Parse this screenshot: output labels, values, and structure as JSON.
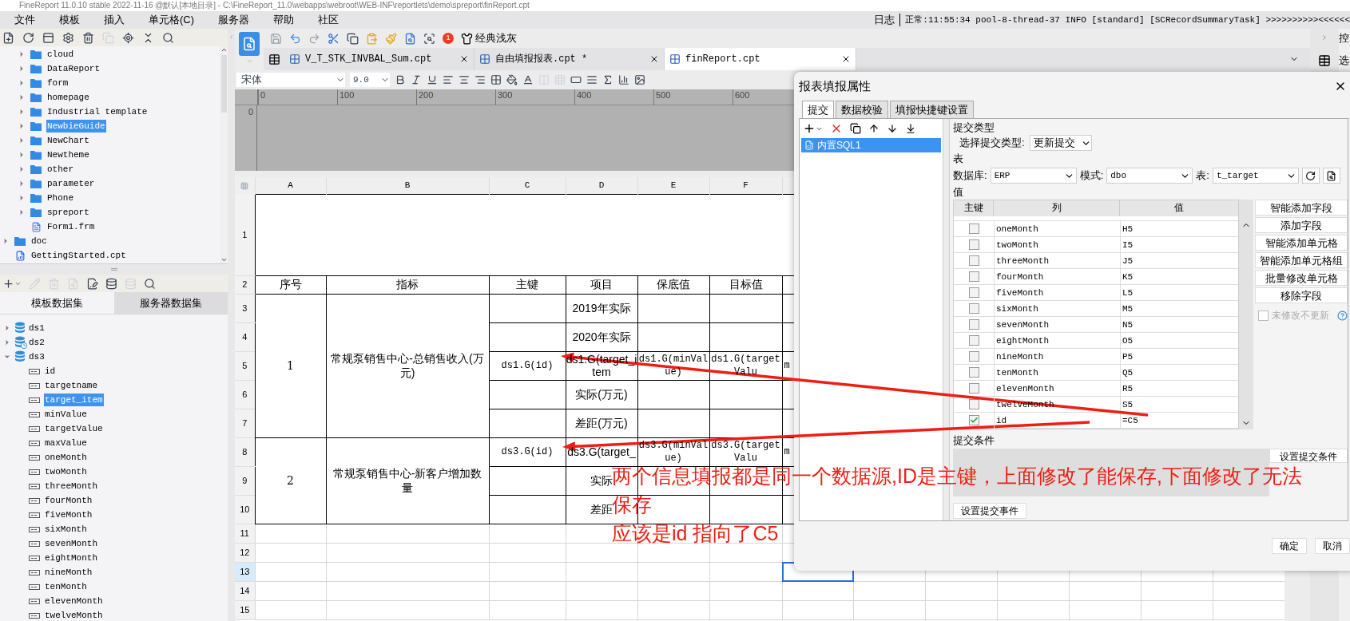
{
  "window": {
    "title": "FineReport 11.0.10 stable 2022-11-16 @默认[本地目录]  - C:\\FineReport_11.0\\webapps\\webroot\\WEB-INF\\reportlets\\demo\\spreport\\finReport.cpt"
  },
  "menu": [
    "文件",
    "模板",
    "插入",
    "单元格(C)",
    "服务器",
    "帮助",
    "社区"
  ],
  "log": {
    "label": "日志",
    "message": "正常:11:55:34 pool-8-thread-37 INFO [standard] [SCRecordSummaryTask] >>>>>>>>>><<<<<<"
  },
  "template_tree": [
    {
      "children": [
        {
          "label": "cloud",
          "kind": "folder",
          "expanded": false,
          "selected": false
        },
        {
          "label": "DataReport",
          "kind": "folder",
          "expanded": false,
          "selected": false
        },
        {
          "label": "form",
          "kind": "folder",
          "expanded": false,
          "selected": false
        },
        {
          "label": "homepage",
          "kind": "folder",
          "expanded": false,
          "selected": false
        },
        {
          "label": "Industrial template",
          "kind": "folder",
          "expanded": false,
          "selected": false
        },
        {
          "label": "NewbieGuide",
          "kind": "folder",
          "expanded": false,
          "selected": true
        },
        {
          "label": "NewChart",
          "kind": "folder",
          "expanded": false,
          "selected": false
        },
        {
          "label": "Newtheme",
          "kind": "folder",
          "expanded": false,
          "selected": false
        },
        {
          "label": "other",
          "kind": "folder",
          "expanded": false,
          "selected": false
        },
        {
          "label": "parameter",
          "kind": "folder",
          "expanded": false,
          "selected": false
        },
        {
          "label": "Phone",
          "kind": "folder",
          "expanded": false,
          "selected": false
        },
        {
          "label": "spreport",
          "kind": "folder",
          "expanded": false,
          "selected": false
        },
        {
          "label": "Form1.frm",
          "kind": "form",
          "selected": false
        }
      ]
    },
    {
      "label": "doc",
      "kind": "folder",
      "expanded": false,
      "selected": false
    },
    {
      "label": "GettingStarted.cpt",
      "kind": "report",
      "selected": false
    }
  ],
  "dataset_panel": {
    "tabs": [
      {
        "label": "模板数据集",
        "selected": true
      },
      {
        "label": "服务器数据集",
        "selected": false
      }
    ],
    "datasets": [
      {
        "label": "ds1",
        "kind": "plain",
        "expanded": false
      },
      {
        "label": "ds2",
        "kind": "timed",
        "expanded": false
      },
      {
        "label": "ds3",
        "kind": "plain",
        "expanded": true,
        "children": [
          {
            "label": "id",
            "selected": false
          },
          {
            "label": "targetname",
            "selected": false
          },
          {
            "label": "target_item",
            "selected": true
          },
          {
            "label": "minValue",
            "selected": false
          },
          {
            "label": "targetValue",
            "selected": false
          },
          {
            "label": "maxValue",
            "selected": false
          },
          {
            "label": "oneMonth",
            "selected": false
          },
          {
            "label": "twoMonth",
            "selected": false
          },
          {
            "label": "threeMonth",
            "selected": false
          },
          {
            "label": "fourMonth",
            "selected": false
          },
          {
            "label": "fiveMonth",
            "selected": false
          },
          {
            "label": "sixMonth",
            "selected": false
          },
          {
            "label": "sevenMonth",
            "selected": false
          },
          {
            "label": "eightMonth",
            "selected": false
          },
          {
            "label": "nineMonth",
            "selected": false
          },
          {
            "label": "tenMonth",
            "selected": false
          },
          {
            "label": "elevenMonth",
            "selected": false
          },
          {
            "label": "twelveMonth",
            "selected": false
          }
        ]
      }
    ]
  },
  "editor": {
    "notification_count": "1",
    "theme": "经典浅灰",
    "tabs": [
      {
        "label": "V_T_STK_INVBAL_Sum.cpt",
        "selected": false
      },
      {
        "label": "自由填报报表.cpt *",
        "selected": false
      },
      {
        "label": "finReport.cpt",
        "selected": true
      }
    ],
    "font": "宋体",
    "font_size": "9.0",
    "ruler": [
      "0",
      "100",
      "200",
      "300",
      "400",
      "500",
      "600"
    ],
    "vertical_ruler": "0"
  },
  "sheet": {
    "columns": [
      "A",
      "B",
      "C",
      "D",
      "E",
      "F"
    ],
    "header": [
      "序号",
      "指标",
      "主键",
      "项目",
      "保底值",
      "目标值"
    ],
    "groups": [
      {
        "index": "1",
        "indicator": "常规泵销售中心-总销售收入(万元)",
        "rows": [
          {
            "item": "2019年实际"
          },
          {
            "item": "2020年实际"
          },
          {
            "key": "ds1.G(id)",
            "item": "ds1.G(target_item",
            "floor_value": "ds1.G(minValue)",
            "target_value": "ds1.G(targetValu",
            "column_7": "m"
          },
          {
            "item": "实际(万元)"
          },
          {
            "item": "差距(万元)"
          }
        ]
      },
      {
        "index": "2",
        "indicator": "常规泵销售中心-新客户增加数量",
        "rows": [
          {
            "key": "ds3.G(id)",
            "item": "ds3.G(target_",
            "floor_value": "ds3.G(minValue)",
            "target_value": "ds3.G(targetValu",
            "column_7": "m"
          },
          {
            "item": "实际"
          },
          {
            "item": "差距"
          }
        ]
      }
    ],
    "rows": [
      {
        "label": "1",
        "selected": false
      },
      {
        "label": "2",
        "selected": false
      },
      {
        "label": "3",
        "selected": false
      },
      {
        "label": "4",
        "selected": false
      },
      {
        "label": "5",
        "selected": false
      },
      {
        "label": "6",
        "selected": false
      },
      {
        "label": "7",
        "selected": false
      },
      {
        "label": "8",
        "selected": false
      },
      {
        "label": "9",
        "selected": false
      },
      {
        "label": "10",
        "selected": false
      },
      {
        "label": "11",
        "selected": false
      },
      {
        "label": "12",
        "selected": false
      },
      {
        "label": "13",
        "selected": true
      },
      {
        "label": "14",
        "selected": false
      },
      {
        "label": "15",
        "selected": false
      }
    ]
  },
  "side_panel": {
    "labels": [
      "控",
      "选"
    ]
  },
  "dialog": {
    "title": "报表填报属性",
    "tabs": [
      {
        "label": "提交",
        "selected": true
      },
      {
        "label": "数据校验",
        "selected": false
      },
      {
        "label": "填报快捷键设置",
        "selected": false
      }
    ],
    "statements": [
      {
        "label": "内置SQL1",
        "selected": true
      }
    ],
    "submit_type": {
      "section": "提交类型",
      "label": "选择提交类型:",
      "value": "更新提交"
    },
    "table": {
      "section": "表",
      "database_label": "数据库:",
      "database": "ERP",
      "schema_label": "模式:",
      "schema": "dbo",
      "table_label": "表:",
      "table": "t_target"
    },
    "values": {
      "section": "值",
      "columns": [
        "主键",
        "列",
        "值"
      ],
      "fields": [
        {
          "primary_key": false,
          "column": "oneMonth",
          "value": "H5"
        },
        {
          "primary_key": false,
          "column": "twoMonth",
          "value": "I5"
        },
        {
          "primary_key": false,
          "column": "threeMonth",
          "value": "J5"
        },
        {
          "primary_key": false,
          "column": "fourMonth",
          "value": "K5"
        },
        {
          "primary_key": false,
          "column": "fiveMonth",
          "value": "L5"
        },
        {
          "primary_key": false,
          "column": "sixMonth",
          "value": "M5"
        },
        {
          "primary_key": false,
          "column": "sevenMonth",
          "value": "N5"
        },
        {
          "primary_key": false,
          "column": "eightMonth",
          "value": "O5"
        },
        {
          "primary_key": false,
          "column": "nineMonth",
          "value": "P5"
        },
        {
          "primary_key": false,
          "column": "tenMonth",
          "value": "Q5"
        },
        {
          "primary_key": false,
          "column": "elevenMonth",
          "value": "R5"
        },
        {
          "primary_key": false,
          "column": "twelveMonth",
          "value": "S5"
        },
        {
          "primary_key": true,
          "column": "id",
          "value": "=C5"
        }
      ],
      "buttons": [
        "智能添加字段",
        "添加字段",
        "智能添加单元格",
        "智能添加单元格组",
        "批量修改单元格",
        "移除字段"
      ],
      "skip_unchanged": {
        "label": "未修改不更新",
        "checked": false,
        "disabled": true
      }
    },
    "condition": {
      "section": "提交条件",
      "button": "设置提交条件"
    },
    "event_button": "设置提交事件",
    "buttons": [
      "确定",
      "取消"
    ]
  },
  "annotation": {
    "note_lines": [
      "两个信息填报都是同一个数据源,ID是主键，上面修改了能保存,下面修改了无法",
      "保存"
    ],
    "conclusion": "应该是id 指向了C5"
  }
}
